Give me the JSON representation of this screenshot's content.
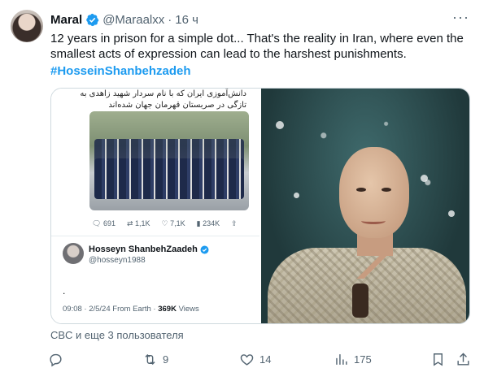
{
  "author": {
    "display_name": "Maral",
    "handle": "@Maraalxx",
    "separator": "·",
    "time": "16 ч",
    "verified_icon": "verified-badge-icon"
  },
  "tweet": {
    "text": "12 years in prison for a simple dot... That's the reality in Iran, where even the smallest acts of expression can lead to the harshest punishments.",
    "hashtag": "#HosseinShanbehzadeh"
  },
  "embedded_screenshot": {
    "persian_caption": "دانش‌آموزی ایران که با نام سردار شهید زاهدی به تازگی در صربستان قهرمان جهان شده‌اند",
    "stats": {
      "replies": "691",
      "retweets": "1,1K",
      "likes": "7,1K",
      "views": "234K"
    },
    "quoted_user": {
      "name": "Hosseyn ShanbehZaadeh",
      "handle": "@hosseyn1988",
      "body": "."
    },
    "footer": {
      "timestamp": "09:08 · 2/5/24 From Earth · ",
      "views_count": "369K",
      "views_label": " Views"
    }
  },
  "liked_by": "CBC и еще 3 пользователя",
  "actions": {
    "reply_count": "",
    "retweet_count": "9",
    "like_count": "14",
    "views_count": "175"
  },
  "colors": {
    "accent": "#1d9bf0",
    "text": "#0f1419",
    "muted": "#536471"
  }
}
